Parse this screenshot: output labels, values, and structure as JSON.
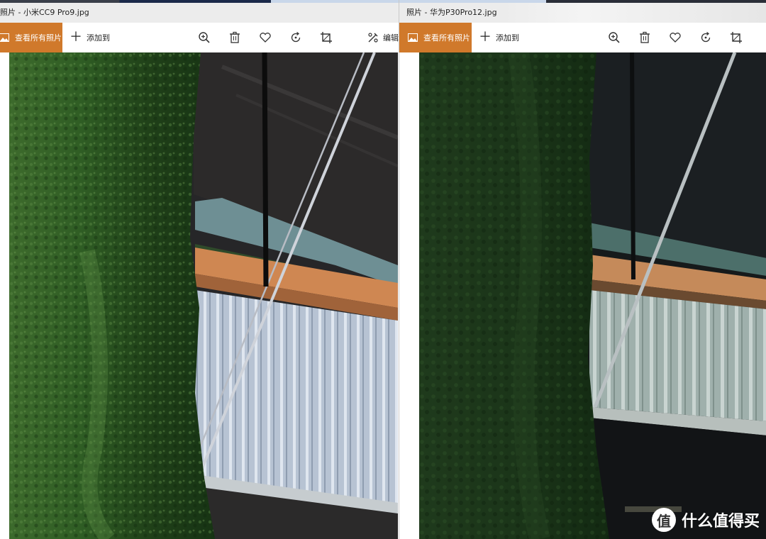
{
  "left_window": {
    "title": "照片 - 小米CC9 Pro9.jpg",
    "toolbar": {
      "view_all_label": "查看所有照片",
      "add_to_label": "添加到",
      "edit_label": "编辑",
      "icons": [
        "zoom-in-icon",
        "delete-icon",
        "favorite-heart-icon",
        "rotate-icon",
        "crop-icon",
        "edit-icon"
      ]
    }
  },
  "right_window": {
    "title": "照片 - 华为P30Pro12.jpg",
    "toolbar": {
      "view_all_label": "查看所有照片",
      "add_to_label": "添加到",
      "icons": [
        "zoom-in-icon",
        "delete-icon",
        "favorite-heart-icon",
        "rotate-icon",
        "crop-icon"
      ]
    }
  },
  "watermark": {
    "badge": "值",
    "text": "什么值得买"
  },
  "colors": {
    "accent": "#d0792b",
    "titlebar_bg": "#ececec",
    "toolbar_bg": "#ffffff"
  }
}
